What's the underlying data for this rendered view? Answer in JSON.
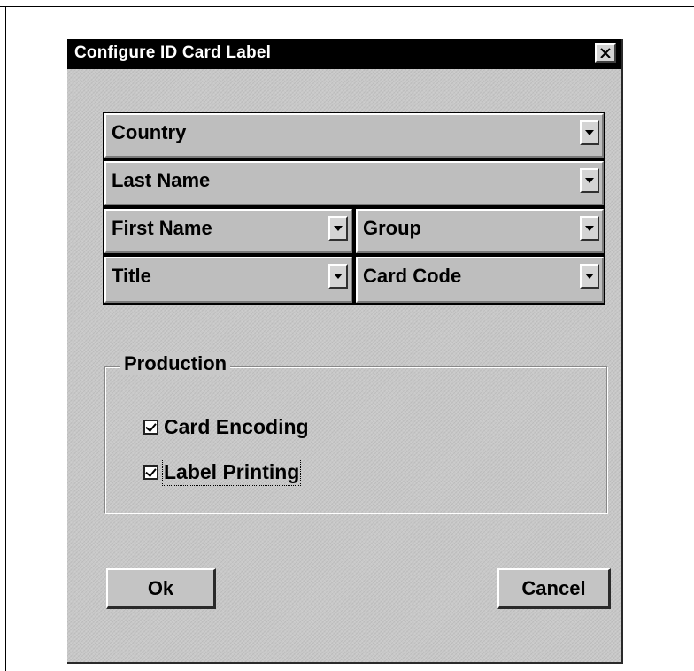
{
  "dialog": {
    "title": "Configure ID Card Label",
    "close_glyph": "✕"
  },
  "fields": {
    "country": "Country",
    "last_name": "Last Name",
    "first_name": "First Name",
    "group": "Group",
    "title": "Title",
    "card_code": "Card Code"
  },
  "production": {
    "legend": "Production",
    "card_encoding": {
      "label": "Card Encoding",
      "checked": true
    },
    "label_printing": {
      "label": "Label Printing",
      "checked": true
    }
  },
  "buttons": {
    "ok": "Ok",
    "cancel": "Cancel"
  },
  "icons": {
    "close": "close-icon",
    "dropdown": "chevron-down-icon",
    "checkbox": "checkmark-icon"
  }
}
